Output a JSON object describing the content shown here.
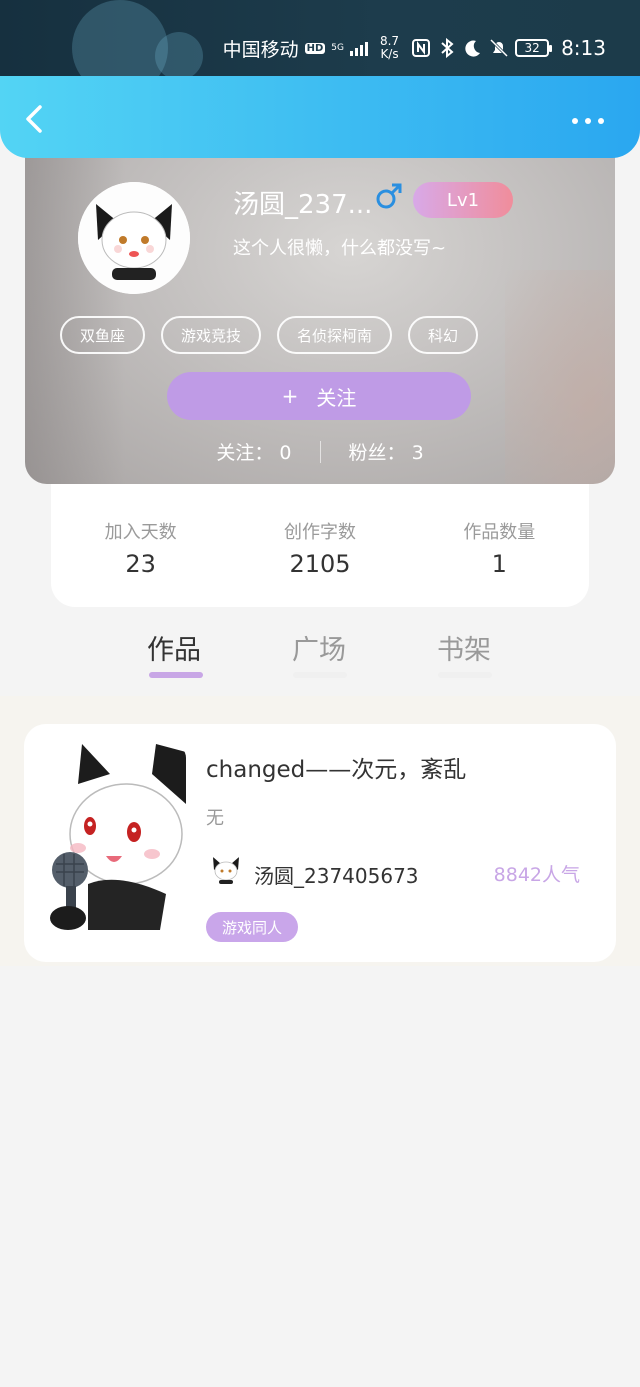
{
  "status_bar": {
    "carrier": "中国移动",
    "hd": "HD",
    "network": "5G",
    "speed_value": "8.7",
    "speed_unit": "K/s",
    "battery": "32",
    "time": "8:13"
  },
  "profile": {
    "username": "汤圆_237...",
    "gender": "♂",
    "level": "Lv1",
    "bio": "这个人很懒，什么都没写~",
    "tags": [
      "双鱼座",
      "游戏竞技",
      "名侦探柯南",
      "科幻"
    ],
    "follow_button": "关注",
    "follow_icon": "+",
    "following_label": "关注：",
    "following_count": "0",
    "fans_label": "粉丝：",
    "fans_count": "3"
  },
  "stats": [
    {
      "label": "加入天数",
      "value": "23"
    },
    {
      "label": "创作字数",
      "value": "2105"
    },
    {
      "label": "作品数量",
      "value": "1"
    }
  ],
  "tabs": [
    {
      "label": "作品",
      "active": true
    },
    {
      "label": "广场",
      "active": false
    },
    {
      "label": "书架",
      "active": false
    }
  ],
  "work": {
    "title": "changed——次元，紊乱",
    "description": "无",
    "author": "汤圆_237405673",
    "popularity": "8842人气",
    "genre": "游戏同人"
  },
  "colors": {
    "nav_gradient_start": "#53d4f4",
    "nav_gradient_end": "#2aa7f0",
    "accent_purple": "#bf9be6",
    "gender_blue": "#2a8fe0",
    "tab_active": "#333333",
    "tab_inactive": "#999999"
  }
}
